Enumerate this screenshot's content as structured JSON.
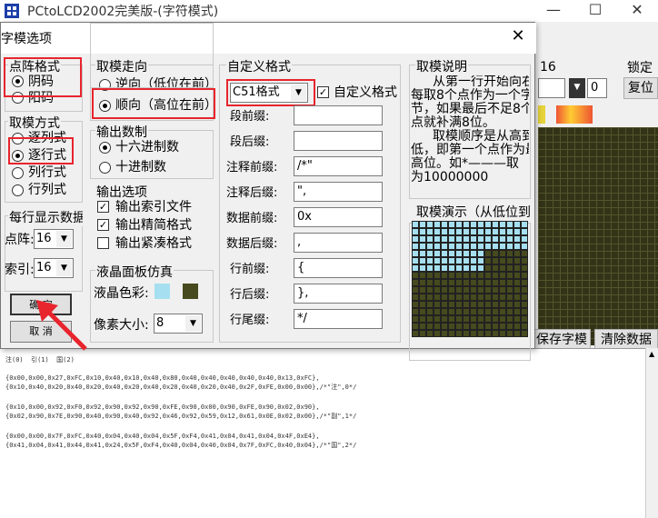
{
  "app": {
    "title": "PCtoLCD2002完美版-(字符模式)",
    "minimize": "—",
    "maximize": "☐",
    "close": "✕"
  },
  "background": {
    "size_label": "16",
    "lock_label": "锁定",
    "stepper_value": "0",
    "restore_label": "复位",
    "save_button": "保存字模",
    "clear_button": "清除数据"
  },
  "output": {
    "header": "注(0)  引(1)  国(2)",
    "lines": [
      "{0x00,0x00,0x27,0xFC,0x10,0x40,0x10,0x40,0x80,0x40,0x40,0x40,0x40,0x40,0x13,0xFC},",
      "{0x10,0x40,0x20,0x40,0x20,0x40,0x20,0x40,0x20,0x40,0x20,0x40,0x2F,0xFE,0x00,0x00},/*\"注\",0*/",
      "",
      "{0x10,0x00,0x92,0xF0,0x92,0x90,0x92,0x90,0xFE,0x90,0x00,0x90,0xFE,0x90,0x02,0x90},",
      "{0x02,0x90,0x7E,0x90,0x40,0x90,0x40,0x92,0x46,0x92,0x59,0x12,0x61,0x0E,0x02,0x00},/*\"副\",1*/",
      "",
      "{0x00,0x00,0x7F,0xFC,0x40,0x04,0x40,0x04,0x5F,0xF4,0x41,0x04,0x41,0x04,0x4F,0xE4},",
      "{0x41,0x04,0x41,0x44,0x41,0x24,0x5F,0xF4,0x40,0x04,0x40,0x04,0x7F,0xFC,0x40,0x04},/*\"国\",2*/"
    ]
  },
  "dialog": {
    "title": "字模选项",
    "close": "✕",
    "dot_format": {
      "label": "点阵格式",
      "options": [
        "阴码",
        "阳码"
      ],
      "selected": "阴码"
    },
    "mode": {
      "label": "取模方式",
      "options": [
        "逐列式",
        "逐行式",
        "列行式",
        "行列式"
      ],
      "selected": "逐行式"
    },
    "per_line": {
      "label": "每行显示数据",
      "dot_label": "点阵:",
      "dot_value": "16",
      "index_label": "索引:",
      "index_value": "16"
    },
    "ok_button": "确  定",
    "cancel_button": "取  消",
    "direction": {
      "label": "取模走向",
      "options": [
        "逆向（低位在前）",
        "顺向（高位在前）"
      ],
      "selected": "顺向（高位在前）"
    },
    "number": {
      "label": "输出数制",
      "options": [
        "十六进制数",
        "十进制数"
      ],
      "selected": "十六进制数"
    },
    "output_opts": {
      "label": "输出选项",
      "items": [
        {
          "label": "输出索引文件",
          "checked": true
        },
        {
          "label": "输出精简格式",
          "checked": true
        },
        {
          "label": "输出紧凑格式",
          "checked": false
        }
      ]
    },
    "lcd": {
      "label": "液晶面板仿真",
      "color_label": "液晶色彩:",
      "pixel_label": "像素大小:",
      "pixel_value": "8",
      "colors": {
        "on": "#a6e0f0",
        "off": "#464a1e"
      }
    },
    "custom": {
      "label": "自定义格式",
      "format_value": "C51格式",
      "checkbox_label": "自定义格式",
      "checked": true,
      "fields": [
        {
          "label": "段前缀:",
          "value": ""
        },
        {
          "label": "段后缀:",
          "value": ""
        },
        {
          "label": "注释前缀:",
          "value": "/*\""
        },
        {
          "label": "注释后缀:",
          "value": "\","
        },
        {
          "label": "数据前缀:",
          "value": "0x"
        },
        {
          "label": "数据后缀:",
          "value": ","
        },
        {
          "label": "行前缀:",
          "value": "{"
        },
        {
          "label": "行后缀:",
          "value": "},"
        },
        {
          "label": "行尾缀:",
          "value": "*/"
        }
      ]
    },
    "explain": {
      "label": "取模说明",
      "lines": [
        "从第一行开始向右",
        "每取8个点作为一个字",
        "节，如果最后不足8个",
        "点就补满8位。",
        "取模顺序是从高到",
        "低，即第一个点作为最",
        "高位。如*———取",
        "为10000000"
      ]
    },
    "preview": {
      "label": "取模演示（从低位到高位）"
    }
  },
  "accent": "#e8242d"
}
